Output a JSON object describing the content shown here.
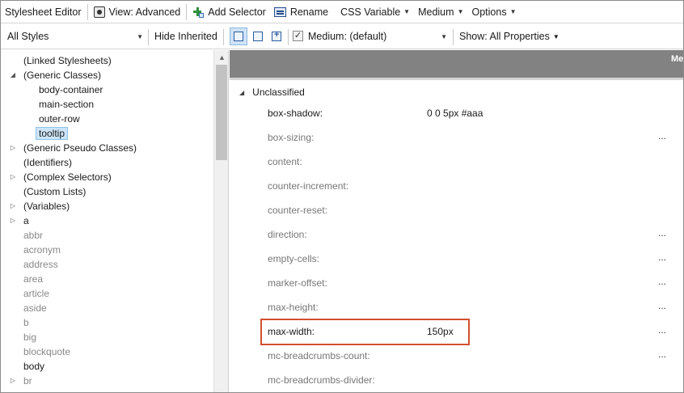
{
  "toolbar": {
    "title": "Stylesheet Editor",
    "view_label": "View: Advanced",
    "add_selector_label": "Add Selector",
    "rename_label": "Rename",
    "css_variable_label": "CSS Variable",
    "medium_label": "Medium",
    "options_label": "Options"
  },
  "filterbar": {
    "styles_select": "All Styles",
    "hide_inherited_label": "Hide Inherited",
    "medium_checked": true,
    "medium_select": "Medium: (default)",
    "show_label": "Show: All Properties"
  },
  "tree": [
    {
      "label": "(Linked Stylesheets)",
      "twisty": ""
    },
    {
      "label": "(Generic Classes)",
      "twisty": "expanded"
    },
    {
      "label": "body-container",
      "twisty": ""
    },
    {
      "label": "main-section",
      "twisty": ""
    },
    {
      "label": "outer-row",
      "twisty": ""
    },
    {
      "label": "tooltip",
      "twisty": "",
      "selected": true
    },
    {
      "label": "(Generic Pseudo Classes)",
      "twisty": "collapsed"
    },
    {
      "label": "(Identifiers)",
      "twisty": ""
    },
    {
      "label": "(Complex Selectors)",
      "twisty": "collapsed"
    },
    {
      "label": "(Custom Lists)",
      "twisty": ""
    },
    {
      "label": "(Variables)",
      "twisty": "collapsed"
    },
    {
      "label": "a",
      "twisty": "collapsed"
    },
    {
      "label": "abbr",
      "twisty": "",
      "muted": true
    },
    {
      "label": "acronym",
      "twisty": "",
      "muted": true
    },
    {
      "label": "address",
      "twisty": "",
      "muted": true
    },
    {
      "label": "area",
      "twisty": "",
      "muted": true
    },
    {
      "label": "article",
      "twisty": "",
      "muted": true
    },
    {
      "label": "aside",
      "twisty": "",
      "muted": true
    },
    {
      "label": "b",
      "twisty": "",
      "muted": true
    },
    {
      "label": "big",
      "twisty": "",
      "muted": true
    },
    {
      "label": "blockquote",
      "twisty": "",
      "muted": true
    },
    {
      "label": "body",
      "twisty": ""
    },
    {
      "label": "br",
      "twisty": "collapsed",
      "muted": true
    }
  ],
  "properties": {
    "header_label": "Medi",
    "group_label": "Unclassified",
    "rows": [
      {
        "name": "box-shadow:",
        "value": "0 0 5px #aaa",
        "more": false,
        "set": true
      },
      {
        "name": "box-sizing:",
        "value": "",
        "more": true,
        "set": false
      },
      {
        "name": "content:",
        "value": "",
        "more": false,
        "set": false
      },
      {
        "name": "counter-increment:",
        "value": "",
        "more": false,
        "set": false
      },
      {
        "name": "counter-reset:",
        "value": "",
        "more": false,
        "set": false
      },
      {
        "name": "direction:",
        "value": "",
        "more": true,
        "set": false
      },
      {
        "name": "empty-cells:",
        "value": "",
        "more": true,
        "set": false
      },
      {
        "name": "marker-offset:",
        "value": "",
        "more": true,
        "set": false
      },
      {
        "name": "max-height:",
        "value": "",
        "more": true,
        "set": false
      },
      {
        "name": "max-width:",
        "value": "150px",
        "more": true,
        "set": true
      },
      {
        "name": "mc-breadcrumbs-count:",
        "value": "",
        "more": true,
        "set": false
      },
      {
        "name": "mc-breadcrumbs-divider:",
        "value": "",
        "more": false,
        "set": false
      }
    ]
  },
  "icons": {
    "view": "eye-icon",
    "add_selector": "add-selector-icon",
    "rename": "rename-icon"
  },
  "colors": {
    "highlight": "#d2502e",
    "selection": "#cce4f7",
    "header_bar": "#828282"
  }
}
